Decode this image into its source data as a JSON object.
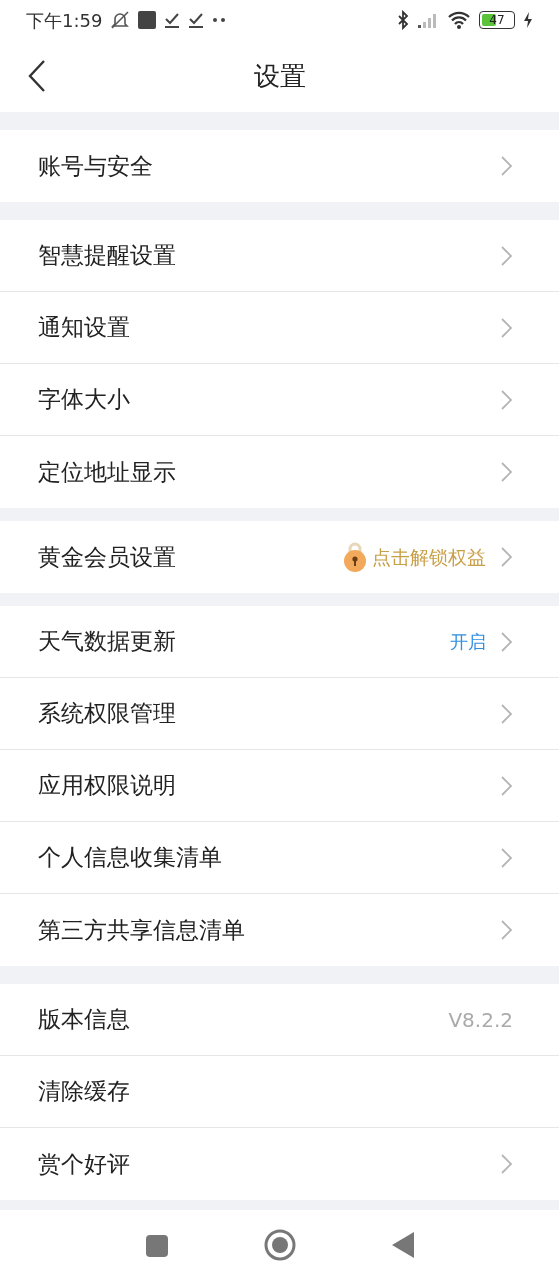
{
  "status_bar": {
    "time": "下午1:59",
    "battery": "47"
  },
  "header": {
    "title": "设置"
  },
  "sections": [
    {
      "items": [
        {
          "label": "账号与安全",
          "chevron": true
        }
      ]
    },
    {
      "items": [
        {
          "label": "智慧提醒设置",
          "chevron": true
        },
        {
          "label": "通知设置",
          "chevron": true
        },
        {
          "label": "字体大小",
          "chevron": true
        },
        {
          "label": "定位地址显示",
          "chevron": true
        }
      ]
    },
    {
      "items": [
        {
          "label": "黄金会员设置",
          "chevron": true,
          "value": {
            "kind": "unlock",
            "text": "点击解锁权益"
          }
        }
      ]
    },
    {
      "items": [
        {
          "label": "天气数据更新",
          "chevron": true,
          "value": {
            "kind": "status",
            "text": "开启"
          }
        },
        {
          "label": "系统权限管理",
          "chevron": true
        },
        {
          "label": "应用权限说明",
          "chevron": true
        },
        {
          "label": "个人信息收集清单",
          "chevron": true
        },
        {
          "label": "第三方共享信息清单",
          "chevron": true
        }
      ]
    },
    {
      "items": [
        {
          "label": "版本信息",
          "chevron": false,
          "value": {
            "kind": "version",
            "text": "V8.2.2"
          }
        },
        {
          "label": "清除缓存",
          "chevron": false
        },
        {
          "label": "赏个好评",
          "chevron": true
        }
      ]
    }
  ]
}
